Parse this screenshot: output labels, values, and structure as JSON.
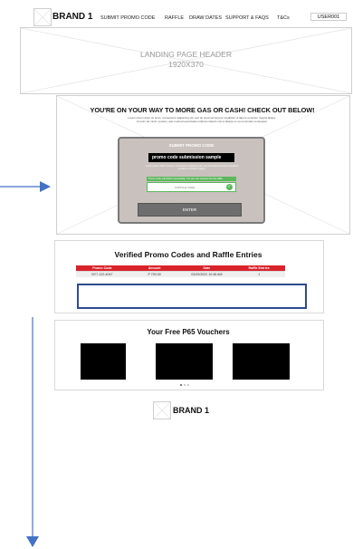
{
  "header": {
    "brand": "BRAND 1",
    "nav": [
      "SUBMIT PROMO CODE",
      "RAFFLE",
      "DRAW DATES",
      "SUPPORT & FAQS",
      "T&Cs"
    ],
    "user": "USER001"
  },
  "hero": {
    "title": "LANDING PAGE HEADER",
    "size": "1920X370"
  },
  "promo_section": {
    "headline": "YOU'RE ON YOUR WAY TO MORE GAS OR CASH! CHECK OUT BELOW!",
    "subtext_line1": "Lorem ipsum dolor sit amet, consectetur adipiscing elit, sed do eiusmod tempor incididunt ut labore et dolore magna aliqua.",
    "subtext_line2": "Ut enim ad minim veniam, quis nostrud exercitation ullamco laboris nisi ut aliquip ex ea commodo consequat.",
    "panel_title": "SUBMIT PROMO CODE",
    "input_value": "promo code submission sample",
    "helper_text": "Lorem ipsum dolor sit amet, consectetur adipiscing elit, sed do eiusmod tempor incididunt ut labore et dolore magna.",
    "success_message": "Promo code submitted successfully. You are now entered into the raffle.",
    "captcha_label": "CAPTCHA CODE",
    "enter_label": "ENTER"
  },
  "verified_section": {
    "title": "Verified Promo Codes and Raffle   Entries",
    "columns": [
      "Promo Code",
      "Amount",
      "Date",
      "Raffle Entries"
    ],
    "rows": [
      [
        "NY7-122-4047",
        "P 700.00",
        "03/20/2022 10:46 AM",
        "1"
      ]
    ]
  },
  "vouchers_section": {
    "title": "Your Free P65 Vouchers"
  },
  "footer": {
    "brand": "BRAND 1"
  },
  "colors": {
    "accent_red": "#d8232a",
    "success_green": "#5cb85c",
    "panel_gray": "#c9c1bd",
    "highlight_blue": "#2e4a8f",
    "arrow_blue": "#4472c4"
  }
}
